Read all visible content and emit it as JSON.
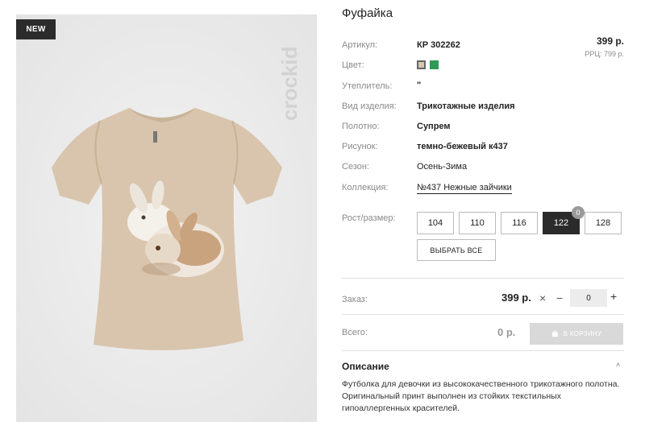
{
  "badge": "NEW",
  "brand": "crockid",
  "product": {
    "title": "Фуфайка",
    "price": "399 р.",
    "rrc": "РРЦ: 799 р."
  },
  "specs": [
    {
      "label": "Артикул:",
      "value": "КР 302262"
    },
    {
      "label": "Цвет:",
      "value": ""
    },
    {
      "label": "Утеплитель:",
      "value": "\""
    },
    {
      "label": "Вид изделия:",
      "value": "Трикотажные изделия"
    },
    {
      "label": "Полотно:",
      "value": "Супрем"
    },
    {
      "label": "Рисунок:",
      "value": "темно-бежевый к437"
    },
    {
      "label": "Сезон:",
      "value": "Осень-Зима"
    },
    {
      "label": "Коллекция:",
      "value": "№437 Нежные зайчики"
    }
  ],
  "colors": [
    {
      "name": "beige",
      "hex": "#d8c7ae"
    },
    {
      "name": "green",
      "hex": "#2e9a56"
    }
  ],
  "sizes": {
    "label": "Рост/размер:",
    "options": [
      "104",
      "110",
      "116",
      "122",
      "128"
    ],
    "selected": "122",
    "selected_count": "0",
    "select_all": "ВЫБРАТЬ ВСЕ"
  },
  "order": {
    "label": "Заказ:",
    "price": "399 р.",
    "times": "×",
    "minus": "−",
    "qty": "0",
    "plus": "+"
  },
  "total": {
    "label": "Всего:",
    "price": "0 р.",
    "cart_button": "В КОРЗИНУ",
    "cart_icon": "cart-icon"
  },
  "description": {
    "title": "Описание",
    "chevron": "˄",
    "text": "Футболка для девочки из высококачественного трикотажного полотна. Оригинальный принт выполнен из стойких текстильных гипоаллергенных красителей."
  },
  "accent": "#2b2b2b"
}
